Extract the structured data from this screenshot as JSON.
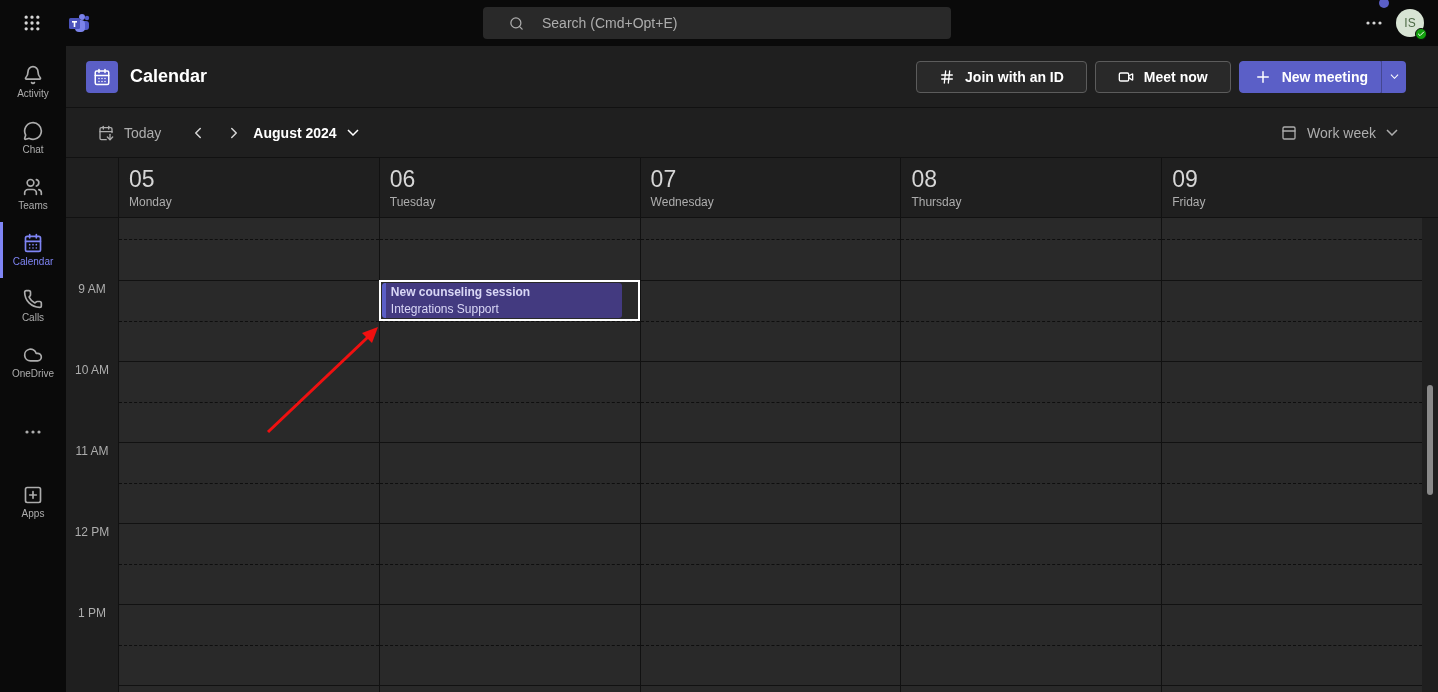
{
  "topbar": {
    "search": {
      "placeholder": "Search (Cmd+Opt+E)"
    },
    "avatar": {
      "initials": "IS"
    }
  },
  "rail": [
    {
      "label": "Activity",
      "kind": "activity",
      "selected": false
    },
    {
      "label": "Chat",
      "kind": "chat",
      "selected": false
    },
    {
      "label": "Teams",
      "kind": "teams",
      "selected": false
    },
    {
      "label": "Calendar",
      "kind": "calendar",
      "selected": true
    },
    {
      "label": "Calls",
      "kind": "calls",
      "selected": false
    },
    {
      "label": "OneDrive",
      "kind": "onedrive",
      "selected": false
    },
    {
      "kind": "more",
      "selected": false
    },
    {
      "label": "Apps",
      "kind": "apps",
      "selected": false
    }
  ],
  "header": {
    "title": "Calendar",
    "buttons": [
      {
        "label": "Join with an ID",
        "kind": "join"
      },
      {
        "label": "Meet now",
        "kind": "meet"
      },
      {
        "label": "New meeting",
        "kind": "new"
      }
    ]
  },
  "toolbar": {
    "today": "Today",
    "month": "August 2024",
    "view": "Work week"
  },
  "days": [
    {
      "date": "05",
      "weekday": "Monday"
    },
    {
      "date": "06",
      "weekday": "Tuesday"
    },
    {
      "date": "07",
      "weekday": "Wednesday"
    },
    {
      "date": "08",
      "weekday": "Thursday"
    },
    {
      "date": "09",
      "weekday": "Friday"
    }
  ],
  "hours": [
    {
      "label": "9 AM",
      "cells": [
        {},
        {
          "events": [
            {
              "title": "New counseling session",
              "organizer": "Integrations Support",
              "selected": true
            }
          ]
        },
        {},
        {},
        {}
      ]
    },
    {
      "label": "10 AM"
    },
    {
      "label": "11 AM"
    },
    {
      "label": "12 PM"
    },
    {
      "label": "1 PM"
    }
  ]
}
